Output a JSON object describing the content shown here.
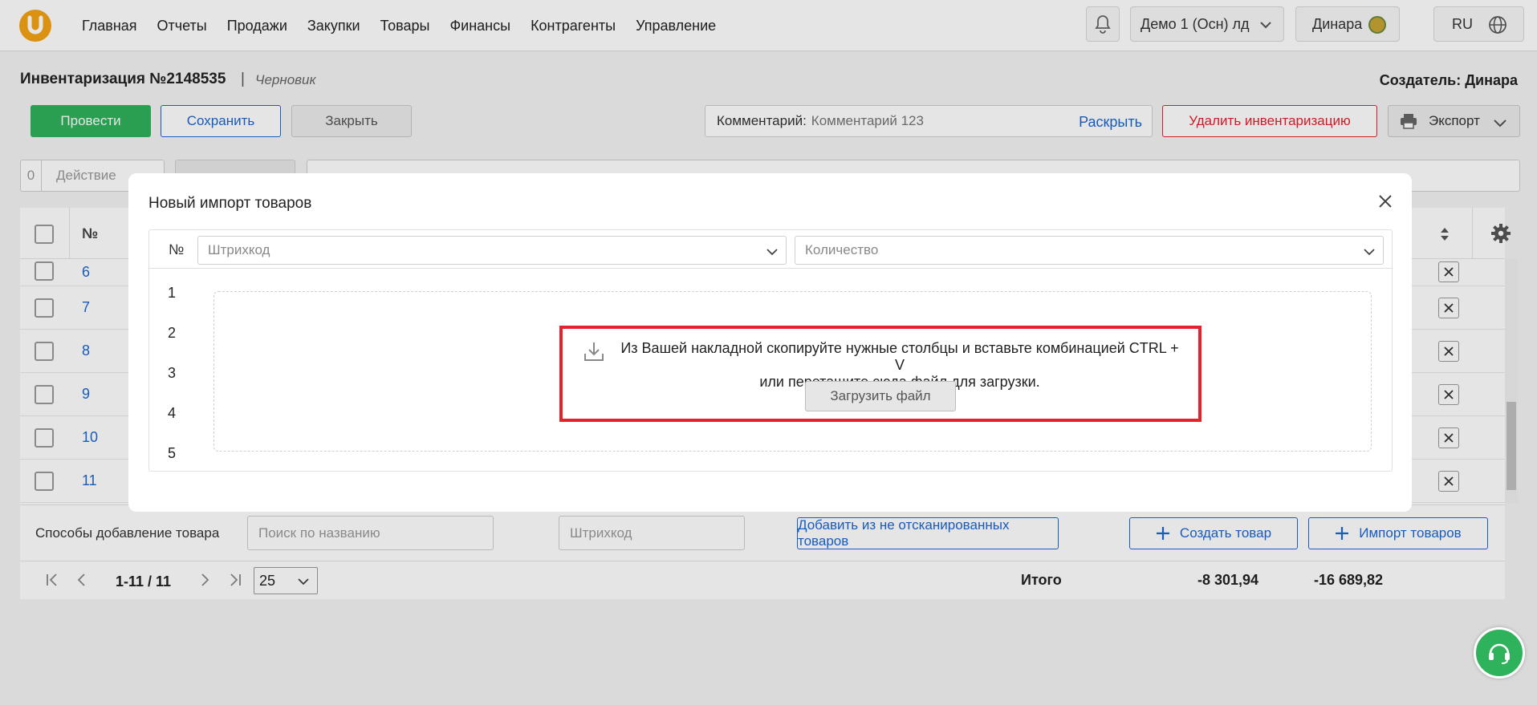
{
  "nav": {
    "items": [
      "Главная",
      "Отчеты",
      "Продажи",
      "Закупки",
      "Товары",
      "Финансы",
      "Контрагенты",
      "Управление"
    ]
  },
  "topbar": {
    "org": "Демо 1 (Осн) лд",
    "user": "Динара",
    "lang": "RU"
  },
  "document": {
    "title": "Инвентаризация №2148535",
    "separator": "|",
    "status": "Черновик",
    "creator": "Создатель: Динара"
  },
  "actions": {
    "conduct": "Провести",
    "save": "Сохранить",
    "close": "Закрыть",
    "comment_label": "Комментарий:",
    "comment_value": "Комментарий 123",
    "comment_expand": "Раскрыть",
    "delete": "Удалить инвентаризацию",
    "export": "Экспорт"
  },
  "toolbar": {
    "selected_count": "0",
    "action_label": "Действие"
  },
  "table": {
    "header_num": "№",
    "rows": [
      "6",
      "7",
      "8",
      "9",
      "10",
      "11"
    ]
  },
  "add_row": {
    "label": "Способы добавление товара",
    "search_placeholder": "Поиск по названию",
    "barcode_placeholder": "Штрихкод",
    "from_unscanned": "Добавить из не отсканированных товаров",
    "create_product": "Создать товар",
    "import_products": "Импорт товаров"
  },
  "pager": {
    "range": "1-11 / 11",
    "page_size": "25",
    "total_label": "Итого",
    "sum1": "-8 301,94",
    "sum2": "-16 689,82"
  },
  "modal": {
    "title": "Новый импорт товаров",
    "col_num": "№",
    "col1": "Штрихкод",
    "col2": "Количество",
    "row_numbers": [
      "1",
      "2",
      "3",
      "4",
      "5"
    ],
    "hint_line1": "Из Вашей накладной скопируйте нужные столбцы и вставьте комбинацией CTRL + V",
    "hint_line2": "или перетащите сюда файл для загрузки.",
    "upload_button": "Загрузить файл"
  },
  "colors": {
    "accent_green": "#2fb25c",
    "link_blue": "#1a67d2",
    "danger_red": "#e5212b",
    "logo_orange": "#f5a314"
  }
}
